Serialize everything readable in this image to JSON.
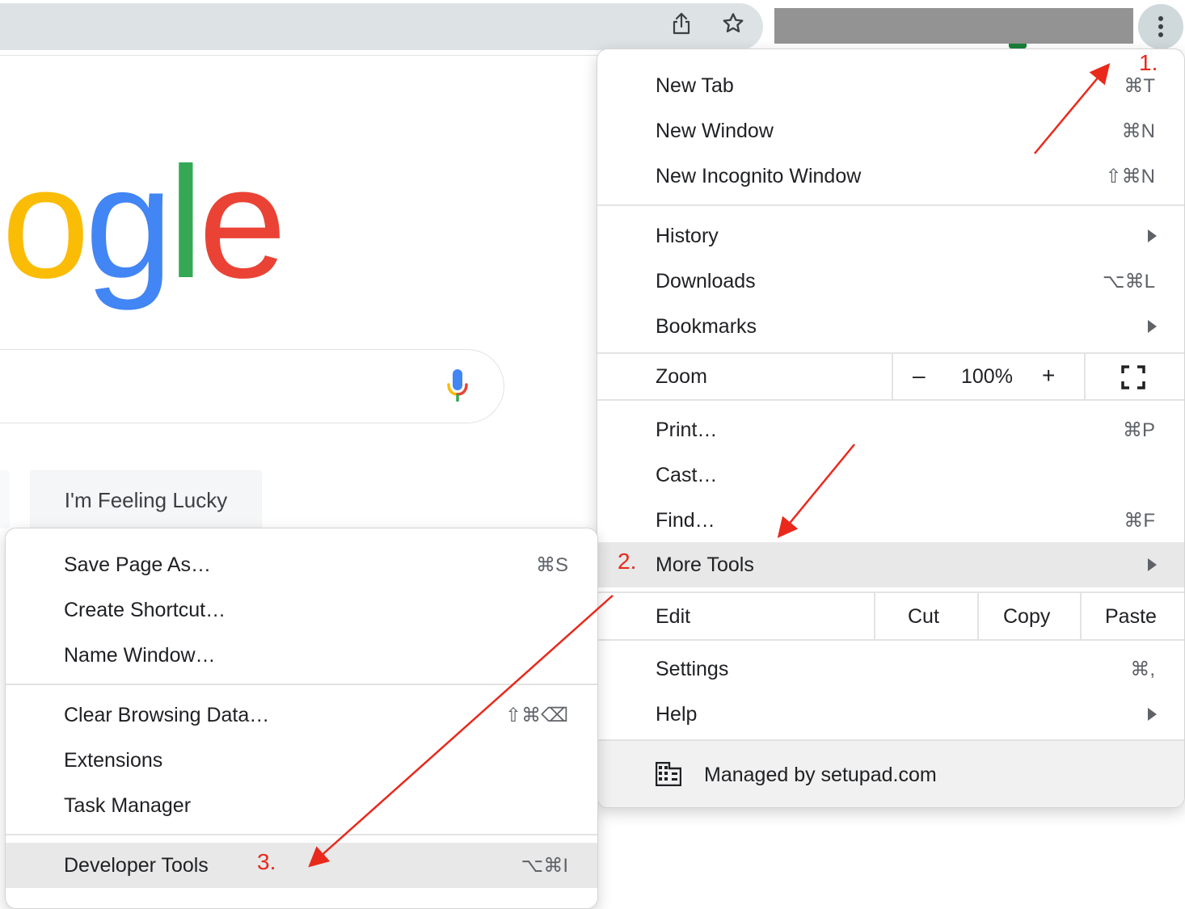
{
  "toolbar": {
    "share_icon": "share-icon",
    "bookmark_icon": "star-icon",
    "menu_icon": "kebab-menu-icon"
  },
  "page": {
    "logo_letters": [
      {
        "char": "o",
        "color": "#FBBC05"
      },
      {
        "char": "g",
        "color": "#4285F4"
      },
      {
        "char": "l",
        "color": "#34A853"
      },
      {
        "char": "e",
        "color": "#EA4335"
      }
    ],
    "lucky_button": "I'm Feeling Lucky",
    "mic_icon": "microphone-icon"
  },
  "menu": {
    "items": [
      {
        "label": "New Tab",
        "shortcut": "⌘T"
      },
      {
        "label": "New Window",
        "shortcut": "⌘N"
      },
      {
        "label": "New Incognito Window",
        "shortcut": "⇧⌘N"
      },
      {
        "label": "History",
        "submenu": true
      },
      {
        "label": "Downloads",
        "shortcut": "⌥⌘L"
      },
      {
        "label": "Bookmarks",
        "submenu": true
      },
      {
        "label": "Print…",
        "shortcut": "⌘P"
      },
      {
        "label": "Cast…"
      },
      {
        "label": "Find…",
        "shortcut": "⌘F"
      },
      {
        "label": "More Tools",
        "submenu": true,
        "highlighted": true
      },
      {
        "label": "Settings",
        "shortcut": "⌘,"
      },
      {
        "label": "Help",
        "submenu": true
      }
    ],
    "zoom": {
      "label": "Zoom",
      "minus": "–",
      "value": "100%",
      "plus": "+"
    },
    "edit": {
      "label": "Edit",
      "cut": "Cut",
      "copy": "Copy",
      "paste": "Paste"
    },
    "managed": "Managed by setupad.com"
  },
  "submenu": {
    "items": [
      {
        "label": "Save Page As…",
        "shortcut": "⌘S"
      },
      {
        "label": "Create Shortcut…"
      },
      {
        "label": "Name Window…"
      },
      {
        "label": "Clear Browsing Data…",
        "shortcut": "⇧⌘⌫"
      },
      {
        "label": "Extensions"
      },
      {
        "label": "Task Manager"
      },
      {
        "label": "Developer Tools",
        "shortcut": "⌥⌘I",
        "highlighted": true
      }
    ]
  },
  "annotations": {
    "step1": "1.",
    "step2": "2.",
    "step3": "3.",
    "color": "#E8291C"
  }
}
